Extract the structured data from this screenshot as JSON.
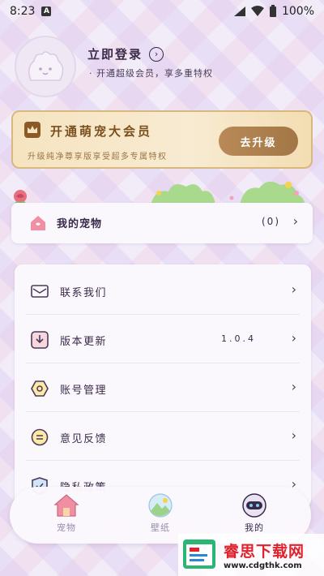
{
  "status_bar": {
    "time": "8:23",
    "battery": "100%"
  },
  "profile": {
    "login_title": "立即登录",
    "login_arrow": "›",
    "subtitle": "· 开通超级会员，享多重特权"
  },
  "vip": {
    "title": "开通萌宠大会员",
    "subtitle": "升级纯净尊享版享受超多专属特权",
    "button": "去升级"
  },
  "pet": {
    "label": "我的宠物",
    "count": "(0)"
  },
  "menu": {
    "items": [
      {
        "label": "联系我们",
        "value": "",
        "icon": "mail-icon"
      },
      {
        "label": "版本更新",
        "value": "1.0.4",
        "icon": "download-icon"
      },
      {
        "label": "账号管理",
        "value": "",
        "icon": "hexagon-icon"
      },
      {
        "label": "意见反馈",
        "value": "",
        "icon": "feedback-icon"
      },
      {
        "label": "隐私政策",
        "value": "",
        "icon": "shield-icon"
      }
    ]
  },
  "tabs": [
    {
      "label": "宠物",
      "icon": "house-icon",
      "active": false
    },
    {
      "label": "壁纸",
      "icon": "landscape-icon",
      "active": false
    },
    {
      "label": "我的",
      "icon": "robot-icon",
      "active": true
    }
  ],
  "watermark": {
    "title": "睿思下载网",
    "url": "www.cdgthk.com"
  },
  "colors": {
    "accent_gold": "#a27646",
    "vip_text": "#7a4f1e",
    "text_dark": "#3a2a4a",
    "brand_red": "#e0222d"
  }
}
